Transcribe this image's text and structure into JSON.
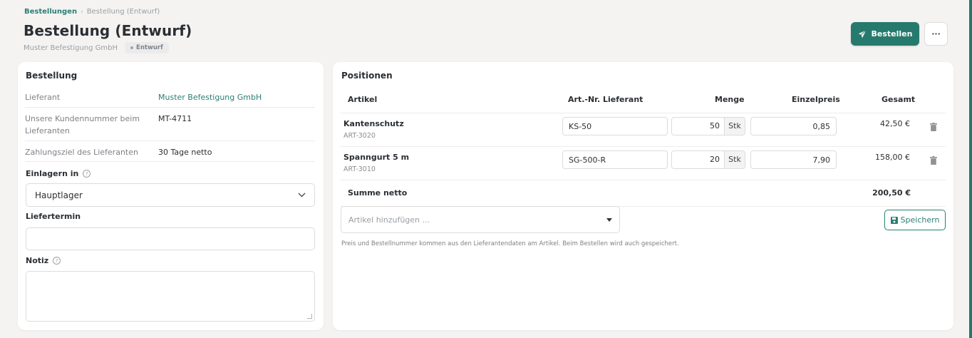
{
  "breadcrumb": {
    "parent": "Bestellungen",
    "separator": "›",
    "current": "Bestellung (Entwurf)"
  },
  "header": {
    "title": "Bestellung (Entwurf)",
    "supplier": "Muster Befestigung GmbH",
    "status": "Entwurf",
    "order_button": "Bestellen",
    "more_button": "···"
  },
  "order_card": {
    "title": "Bestellung",
    "rows": [
      {
        "label": "Lieferant",
        "value": "Muster Befestigung GmbH"
      },
      {
        "label": "Unsere Kundennummer beim Lieferanten",
        "value": "MT-4711"
      },
      {
        "label": "Zahlungsziel des Lieferanten",
        "value": "30 Tage netto"
      }
    ],
    "storage_label": "Einlagern in",
    "storage_value": "Hauptlager",
    "delivery_label": "Liefertermin",
    "delivery_value": "",
    "note_label": "Notiz",
    "note_value": "",
    "help_glyph": "?"
  },
  "positions": {
    "title": "Positionen",
    "columns": {
      "article": "Artikel",
      "supplier_sku": "Art.-Nr. Lieferant",
      "quantity": "Menge",
      "unit_price": "Einzelpreis",
      "total": "Gesamt"
    },
    "items": [
      {
        "name": "Kantenschutz",
        "sku": "ART-3020",
        "supplier_sku": "KS-50",
        "quantity": "50",
        "unit": "Stk",
        "unit_price": "0,85",
        "total": "42,50 €"
      },
      {
        "name": "Spanngurt 5 m",
        "sku": "ART-3010",
        "supplier_sku": "SG-500-R",
        "quantity": "20",
        "unit": "Stk",
        "unit_price": "7,90",
        "total": "158,00 €"
      }
    ],
    "sum_label": "Summe netto",
    "sum_value": "200,50 €",
    "add_placeholder": "Artikel hinzufügen ...",
    "save_button": "Speichern",
    "hint": "Preis und Bestellnummer kommen aus den Lieferantendaten am Artikel. Beim Bestellen wird auch gespeichert."
  },
  "colors": {
    "accent": "#267a6d",
    "link": "#2a7f75",
    "background": "#f4f3f2"
  },
  "icons": [
    "paper-plane-icon",
    "trash-icon",
    "floppy-disk-icon",
    "chevron-down-icon",
    "help-icon",
    "caret-down-icon"
  ]
}
